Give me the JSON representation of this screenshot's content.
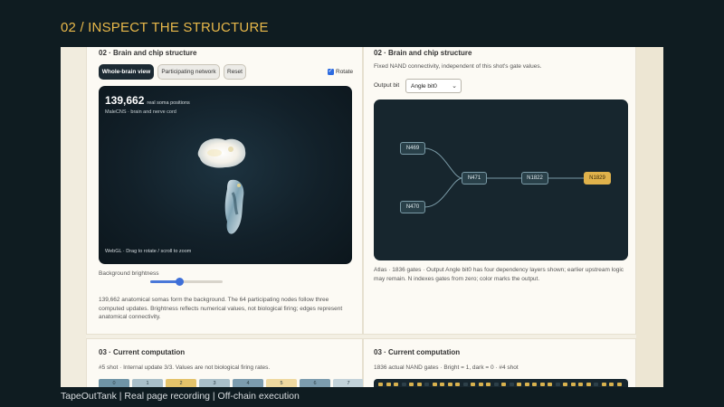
{
  "slide": {
    "title": "02 / INSPECT THE STRUCTURE",
    "footer": "TapeOutTank | Real page recording | Off-chain execution"
  },
  "left_card": {
    "heading": "02 · Brain and chip structure",
    "buttons": [
      "Whole-brain view",
      "Participating network",
      "Reset"
    ],
    "rotate_label": "Rotate",
    "rotate_checked": true,
    "count": "139,662",
    "count_label": "real soma positions",
    "dataset_label": "MaleCNS · brain and nerve cord",
    "webgl_hint": "WebGL · Drag to rotate / scroll to zoom",
    "brightness_label": "Background brightness",
    "brightness_value": 0.4,
    "description": "139,662 anatomical somas form the background. The 64 participating nodes follow three computed updates. Brightness reflects numerical values, not biological firing; edges represent anatomical connectivity."
  },
  "right_card": {
    "heading": "02 · Brain and chip structure",
    "subtitle": "Fixed NAND connectivity, independent of this shot's gate values.",
    "output_bit_label": "Output bit",
    "output_bit_value": "Angle bit0",
    "nodes": {
      "n469": "N469",
      "n470": "N470",
      "n471": "N471",
      "n1822": "N1822",
      "n1829": "N1829"
    },
    "caption": "Atlas · 1836 gates · Output Angle bit0 has four dependency layers shown; earlier upstream logic may remain. N indexes gates from zero; color marks the output."
  },
  "bottom_left": {
    "heading": "03 · Current computation",
    "subtitle": "#5 shot · Internal update 3/3. Values are not biological firing rates.",
    "registers": [
      "0",
      "1",
      "2",
      "3",
      "4",
      "5",
      "6",
      "7"
    ]
  },
  "bottom_right": {
    "heading": "03 · Current computation",
    "subtitle": "1836 actual NAND gates · Bright = 1, dark = 0 · #4 shot",
    "bits": [
      1,
      1,
      1,
      0,
      1,
      1,
      0,
      1,
      1,
      1,
      1,
      0,
      1,
      1,
      1,
      0,
      1,
      0,
      1,
      1,
      1,
      1,
      1,
      0,
      1,
      1,
      1,
      1,
      0,
      1,
      1,
      1
    ]
  },
  "colors": {
    "accent": "#e8b84a",
    "output_node": "#e0b24b",
    "primary_blue": "#2d6be0"
  }
}
